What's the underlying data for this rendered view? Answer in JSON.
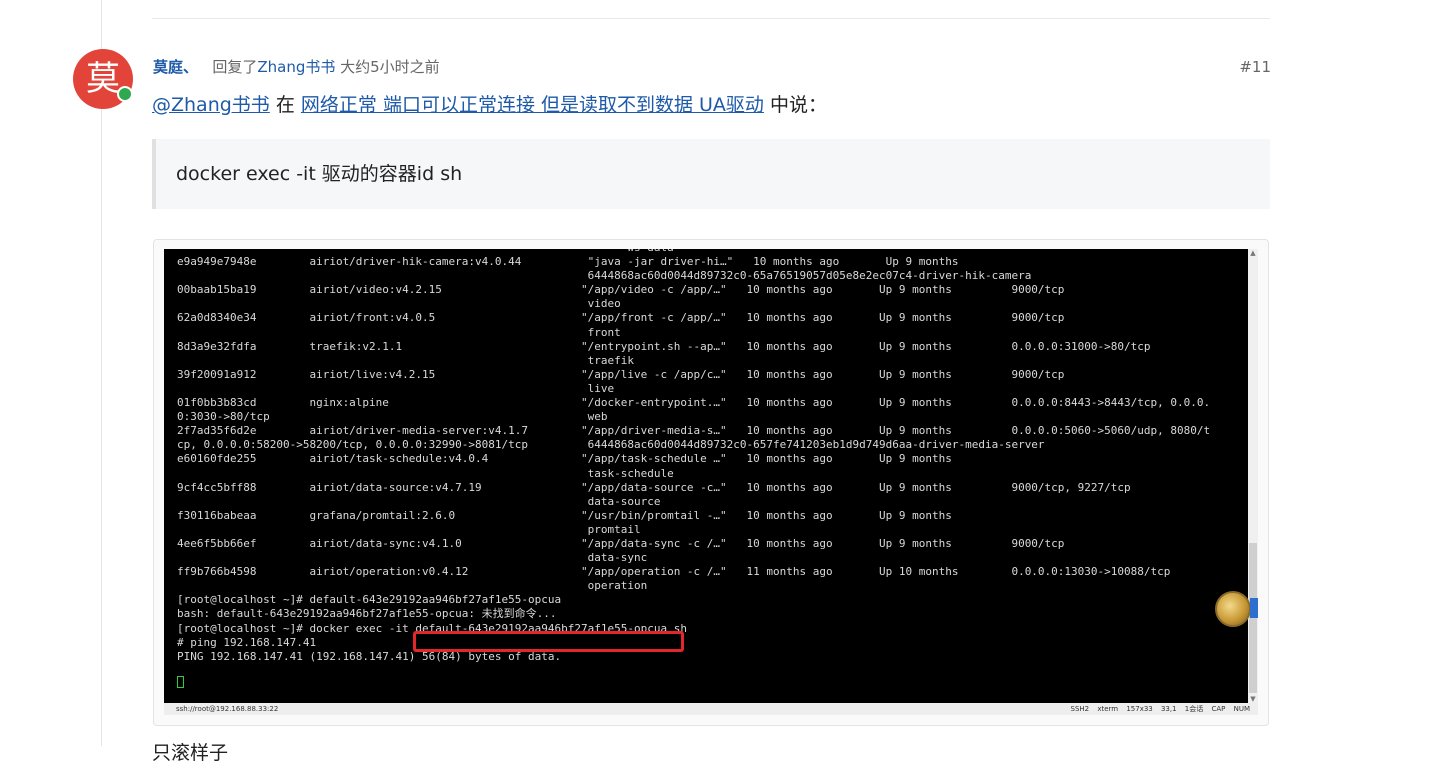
{
  "post": {
    "avatar_char": "莫",
    "author": "莫庭、",
    "replied_prefix": "回复了",
    "replied_to": "Zhang书书",
    "time": "大约5小时之前",
    "number": "#11"
  },
  "quote_line": {
    "mention": "@Zhang书书",
    "in_word": " 在 ",
    "topic_title": "网络正常 端口可以正常连接 但是读取不到数据 UA驱动",
    "said": " 中说："
  },
  "blockquote": {
    "text": "docker exec -it 驱动的容器id sh"
  },
  "terminal": {
    "lines": [
      "                                                                    ws-data",
      "e9a949e7948e        airiot/driver-hik-camera:v4.0.44          \"java -jar driver-hi…\"   10 months ago       Up 9 months",
      "                                                              6444868ac60d0044d89732c0-65a76519057d05e8e2ec07c4-driver-hik-camera",
      "00baab15ba19        airiot/video:v4.2.15                     \"/app/video -c /app/…\"   10 months ago       Up 9 months         9000/tcp",
      "                                                              video",
      "62a0d8340e34        airiot/front:v4.0.5                      \"/app/front -c /app/…\"   10 months ago       Up 9 months         9000/tcp",
      "                                                              front",
      "8d3a9e32fdfa        traefik:v2.1.1                           \"/entrypoint.sh --ap…\"   10 months ago       Up 9 months         0.0.0.0:31000->80/tcp",
      "                                                              traefik",
      "39f20091a912        airiot/live:v4.2.15                      \"/app/live -c /app/c…\"   10 months ago       Up 9 months         9000/tcp",
      "                                                              live",
      "01f0bb3b83cd        nginx:alpine                             \"/docker-entrypoint.…\"   10 months ago       Up 9 months         0.0.0.0:8443->8443/tcp, 0.0.0.",
      "0:3030->80/tcp                                                web",
      "2f7ad35f6d2e        airiot/driver-media-server:v4.1.7        \"/app/driver-media-s…\"   10 months ago       Up 9 months         0.0.0.0:5060->5060/udp, 8080/t",
      "cp, 0.0.0.0:58200->58200/tcp, 0.0.0.0:32990->8081/tcp         6444868ac60d0044d89732c0-657fe741203eb1d9d749d6aa-driver-media-server",
      "e60160fde255        airiot/task-schedule:v4.0.4              \"/app/task-schedule …\"   10 months ago       Up 9 months",
      "                                                              task-schedule",
      "9cf4cc5bff88        airiot/data-source:v4.7.19               \"/app/data-source -c…\"   10 months ago       Up 9 months         9000/tcp, 9227/tcp",
      "                                                              data-source",
      "f30116babeaa        grafana/promtail:2.6.0                   \"/usr/bin/promtail -…\"   10 months ago       Up 9 months",
      "                                                              promtail",
      "4ee6f5bb66ef        airiot/data-sync:v4.1.0                  \"/app/data-sync -c /…\"   10 months ago       Up 9 months         9000/tcp",
      "                                                              data-sync",
      "ff9b766b4598        airiot/operation:v0.4.12                 \"/app/operation -c /…\"   11 months ago       Up 10 months        0.0.0.0:13030->10088/tcp",
      "                                                              operation",
      "[root@localhost ~]# default-643e29192aa946bf27af1e55-opcua",
      "bash: default-643e29192aa946bf27af1e55-opcua: 未找到命令...",
      "[root@localhost ~]# docker exec -it default-643e29192aa946bf27af1e55-opcua sh",
      "# ping 192.168.147.41",
      "PING 192.168.147.41 (192.168.147.41) 56(84) bytes of data."
    ],
    "status_path": "ssh://root@192.168.88.33:22",
    "status_right": "SSH2 xterm 157x33 33,1 1会话 CAP NUM"
  },
  "below_text": "只滚样子",
  "colors": {
    "link": "#1e5aa8",
    "avatar_bg": "#e2443a",
    "presence": "#2fa84f",
    "highlight_box": "#e2262a"
  }
}
